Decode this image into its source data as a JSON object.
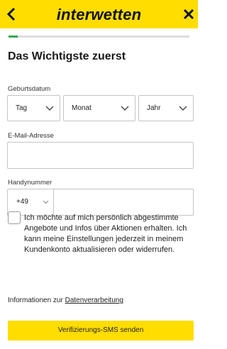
{
  "header": {
    "logo_text": "interwetten",
    "back_icon": "chevron-left-icon",
    "close_icon": "close-icon",
    "background_color": "#ffdd00"
  },
  "progress": {
    "fraction": 0.05,
    "color": "#2fa84f"
  },
  "page": {
    "title": "Das Wichtigste zuerst"
  },
  "birthdate": {
    "label": "Geburtsdatum",
    "day_value": "Tag",
    "month_value": "Monat",
    "year_value": "Jahr"
  },
  "email": {
    "label": "E-Mail-Adresse",
    "value": ""
  },
  "phone": {
    "label": "Handynummer",
    "prefix": "+49",
    "value": ""
  },
  "consent": {
    "checked": false,
    "text": "Ich möchte auf mich persönlich abgestimmte Angebote und Infos über Aktionen erhalten. Ich kann meine Einstellungen jederzeit in meinem Kundenkonto aktualisieren oder widerrufen."
  },
  "info": {
    "prefix_text": "Informationen zur",
    "link_text": "Datenverarbeitung"
  },
  "submit": {
    "label": "Verifizierungs-SMS senden"
  }
}
